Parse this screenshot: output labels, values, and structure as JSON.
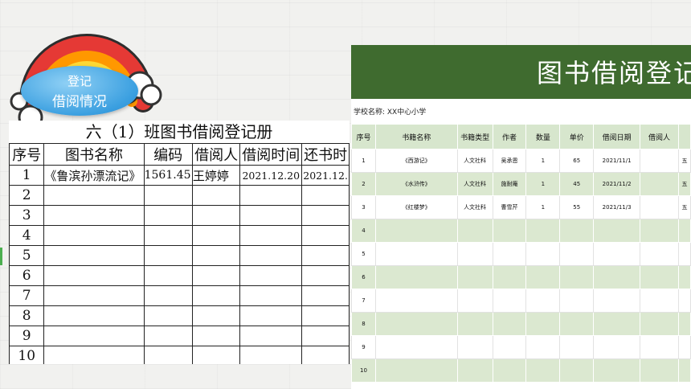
{
  "badge": {
    "line1": "登记",
    "line2": "借阅情况"
  },
  "register": {
    "title": "六（1）班图书借阅登记册",
    "headers": [
      "序号",
      "图书名称",
      "编码",
      "借阅人",
      "借阅时间",
      "还书时"
    ],
    "rows": [
      [
        "1",
        "《鲁滨孙漂流记》",
        "1561.45",
        "王婷婷",
        "2021.12.20",
        "2021.12."
      ],
      [
        "2",
        "",
        "",
        "",
        "",
        ""
      ],
      [
        "3",
        "",
        "",
        "",
        "",
        ""
      ],
      [
        "4",
        "",
        "",
        "",
        "",
        ""
      ],
      [
        "5",
        "",
        "",
        "",
        "",
        ""
      ],
      [
        "6",
        "",
        "",
        "",
        "",
        ""
      ],
      [
        "7",
        "",
        "",
        "",
        "",
        ""
      ],
      [
        "8",
        "",
        "",
        "",
        "",
        ""
      ],
      [
        "9",
        "",
        "",
        "",
        "",
        ""
      ],
      [
        "10",
        "",
        "",
        "",
        "",
        ""
      ]
    ]
  },
  "sheet": {
    "title": "图书借阅登记表",
    "school_label": "学校名称: XX中心小学",
    "headers": [
      "序号",
      "书籍名称",
      "书籍类型",
      "作者",
      "数量",
      "单价",
      "借阅日期",
      "借阅人",
      ""
    ],
    "rows": [
      [
        "1",
        "《西游记》",
        "人文社科",
        "吴承恩",
        "1",
        "65",
        "2021/11/1",
        "",
        "五"
      ],
      [
        "2",
        "《水浒传》",
        "人文社科",
        "施耐庵",
        "1",
        "45",
        "2021/11/2",
        "",
        "五"
      ],
      [
        "3",
        "《红楼梦》",
        "人文社科",
        "曹雪芹",
        "1",
        "55",
        "2021/11/3",
        "",
        "五"
      ],
      [
        "4",
        "",
        "",
        "",
        "",
        "",
        "",
        "",
        ""
      ],
      [
        "5",
        "",
        "",
        "",
        "",
        "",
        "",
        "",
        ""
      ],
      [
        "6",
        "",
        "",
        "",
        "",
        "",
        "",
        "",
        ""
      ],
      [
        "7",
        "",
        "",
        "",
        "",
        "",
        "",
        "",
        ""
      ],
      [
        "8",
        "",
        "",
        "",
        "",
        "",
        "",
        "",
        ""
      ],
      [
        "9",
        "",
        "",
        "",
        "",
        "",
        "",
        "",
        ""
      ],
      [
        "10",
        "",
        "",
        "",
        "",
        "",
        "",
        "",
        ""
      ]
    ]
  },
  "colors": {
    "header_green": "#3f6b2f",
    "row_green": "#dbe8d0",
    "bubble_blue": "#3a9fe0"
  }
}
